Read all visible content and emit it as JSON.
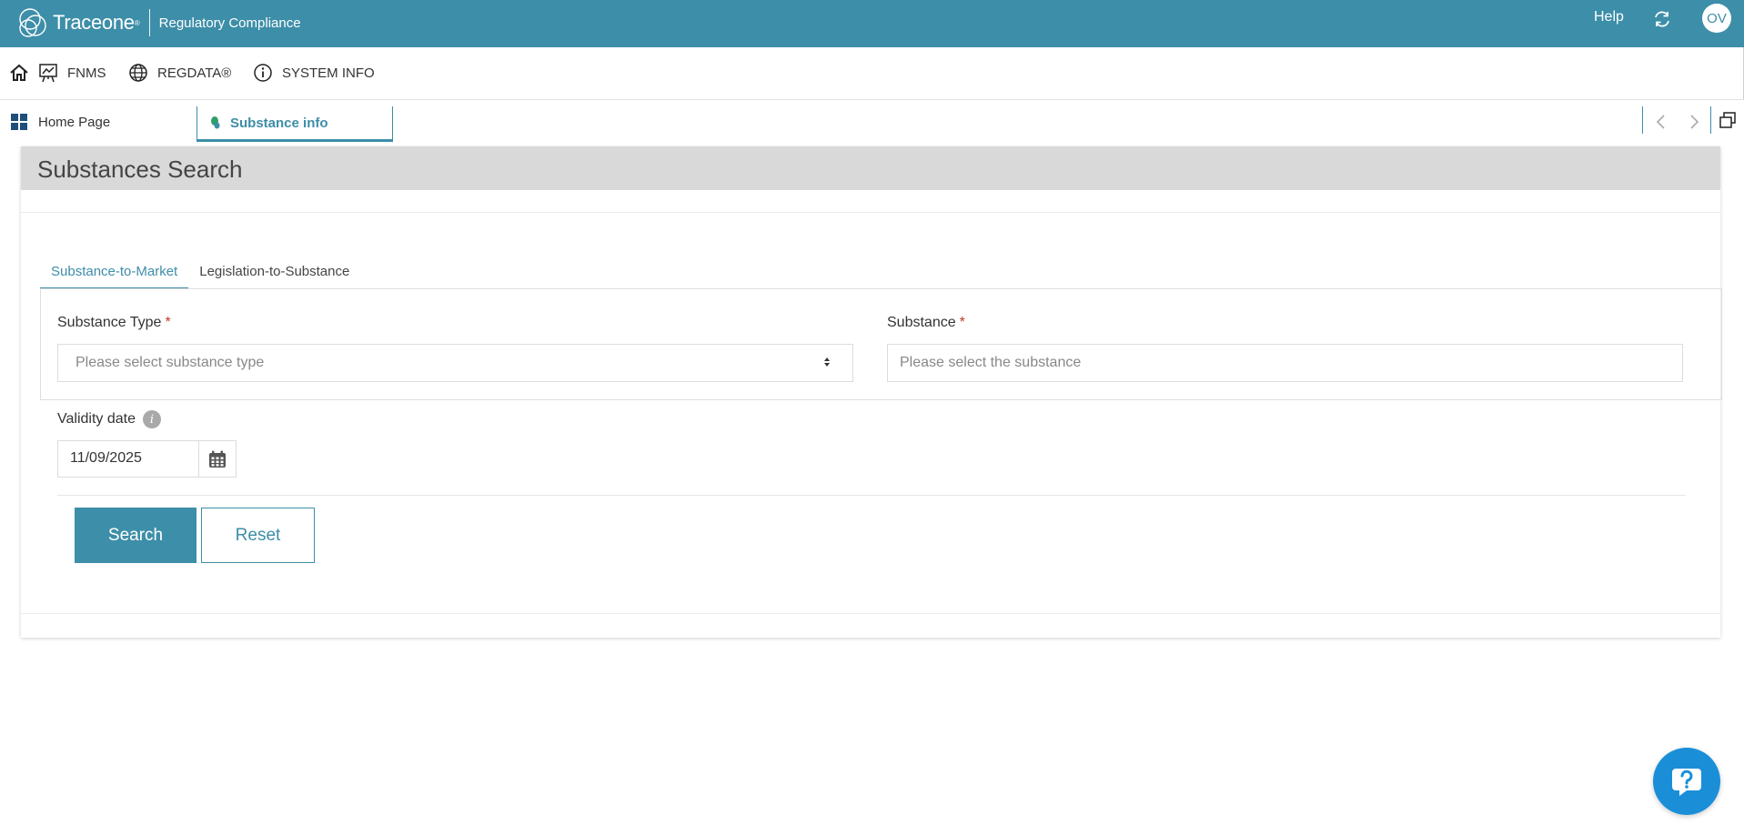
{
  "topbar": {
    "brand_name": "Traceone",
    "brand_mark": "®",
    "product": "Regulatory Compliance",
    "help_label": "Help",
    "refresh_icon": "refresh-icon",
    "avatar_initials": "OV",
    "color": "#3d8ea8"
  },
  "nav": {
    "home_icon": "home-icon",
    "items": [
      {
        "label": "FNMS",
        "icon": "presentation-chart-icon"
      },
      {
        "label": "REGDATA®",
        "icon": "globe-icon"
      },
      {
        "label": "SYSTEM INFO",
        "icon": "info-circle-icon"
      }
    ]
  },
  "tabstrip": {
    "home_label": "Home Page",
    "active_tab_label": "Substance info",
    "active_tab_icon": "substance-icon"
  },
  "page": {
    "title": "Substances Search",
    "tabs": [
      {
        "label": "Substance-to-Market",
        "active": true
      },
      {
        "label": "Legislation-to-Substance",
        "active": false
      }
    ],
    "substance_type": {
      "label": "Substance Type",
      "required_mark": "*",
      "placeholder": "Please select substance type"
    },
    "substance": {
      "label": "Substance",
      "required_mark": "*",
      "placeholder": "Please select the substance"
    },
    "validity": {
      "label": "Validity date",
      "info_glyph": "i",
      "value": "11/09/2025",
      "calendar_icon": "calendar-icon"
    },
    "buttons": {
      "search": "Search",
      "reset": "Reset"
    }
  },
  "chat": {
    "icon": "chat-support-icon",
    "color": "#1a8fd8"
  }
}
